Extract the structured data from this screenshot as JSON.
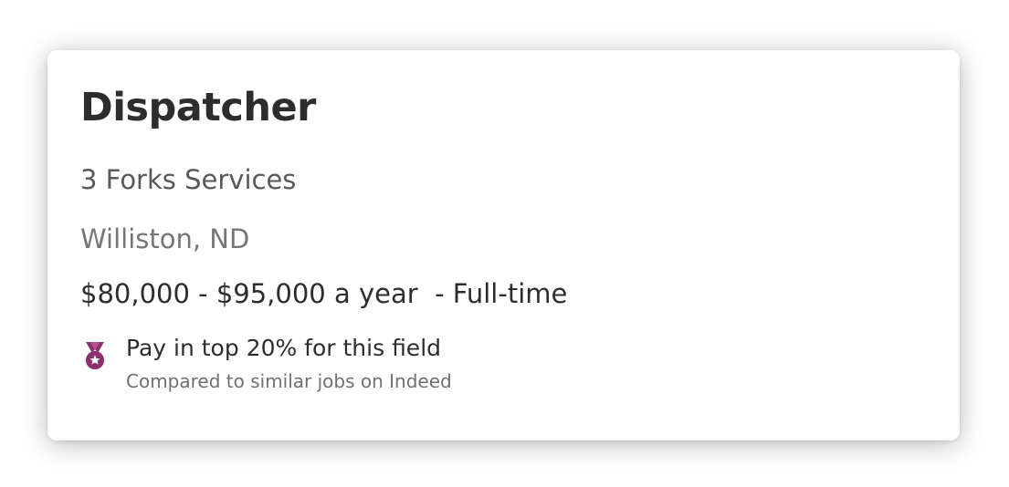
{
  "job": {
    "title": "Dispatcher",
    "company": "3 Forks Services",
    "location": "Williston, ND",
    "salary": "$80,000 - $95,000 a year  - Full-time"
  },
  "pay_badge": {
    "icon": "medal-icon",
    "title": "Pay in top 20% for this field",
    "subtitle": "Compared to similar jobs on Indeed",
    "color": "#8c2f6a"
  }
}
